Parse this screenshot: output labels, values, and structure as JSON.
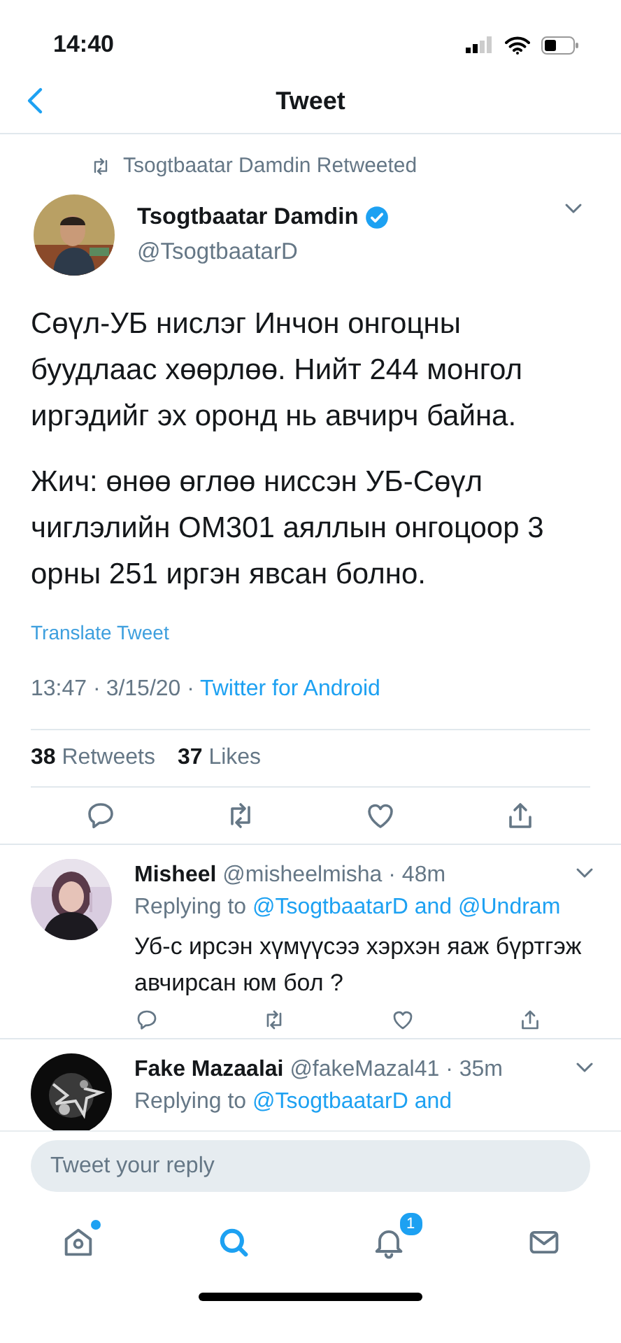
{
  "status_bar": {
    "time": "14:40"
  },
  "header": {
    "title": "Tweet"
  },
  "tweet": {
    "retweeted_by": "Tsogtbaatar Damdin Retweeted",
    "author": {
      "name": "Tsogtbaatar Damdin",
      "handle": "@TsogtbaatarD",
      "verified": true
    },
    "paragraphs": [
      "Сөүл-УБ нислэг Инчон онгоцны буудлаас хөөрлөө. Нийт 244 монгол иргэдийг эх оронд нь авчирч байна.",
      "Жич: өнөө өглөө ниссэн УБ-Сөүл чиглэлийн ОМ301 аяллын онгоцоор 3 орны 251 иргэн явсан болно."
    ],
    "translate": "Translate Tweet",
    "time": "13:47 ·",
    "date": "3/15/20 ·",
    "source": "Twitter for Android",
    "stats": [
      {
        "count": "38",
        "label": "Retweets"
      },
      {
        "count": "37",
        "label": "Likes"
      }
    ]
  },
  "replies": [
    {
      "name": "Misheel",
      "handle": "@misheelmisha",
      "age": "· 48m",
      "replying_prefix": "Replying to",
      "replying_to": "@TsogtbaatarD and @Undram",
      "text": "Уб-с ирсэн хүмүүсээ хэрхэн яаж бүртгэж авчирсан юм бол ?"
    },
    {
      "name": "Fake Mazaalai",
      "handle": "@fakeMazal41",
      "age": "· 35m",
      "replying_prefix": "Replying to",
      "replying_to": "@TsogtbaatarD and"
    }
  ],
  "reply_box": {
    "placeholder": "Tweet your reply"
  },
  "tab_bar": [
    {
      "kind": "home",
      "selected": false,
      "dot": true
    },
    {
      "kind": "search",
      "selected": true
    },
    {
      "kind": "notifications",
      "selected": false,
      "badge": "1"
    },
    {
      "kind": "messages",
      "selected": false
    }
  ]
}
